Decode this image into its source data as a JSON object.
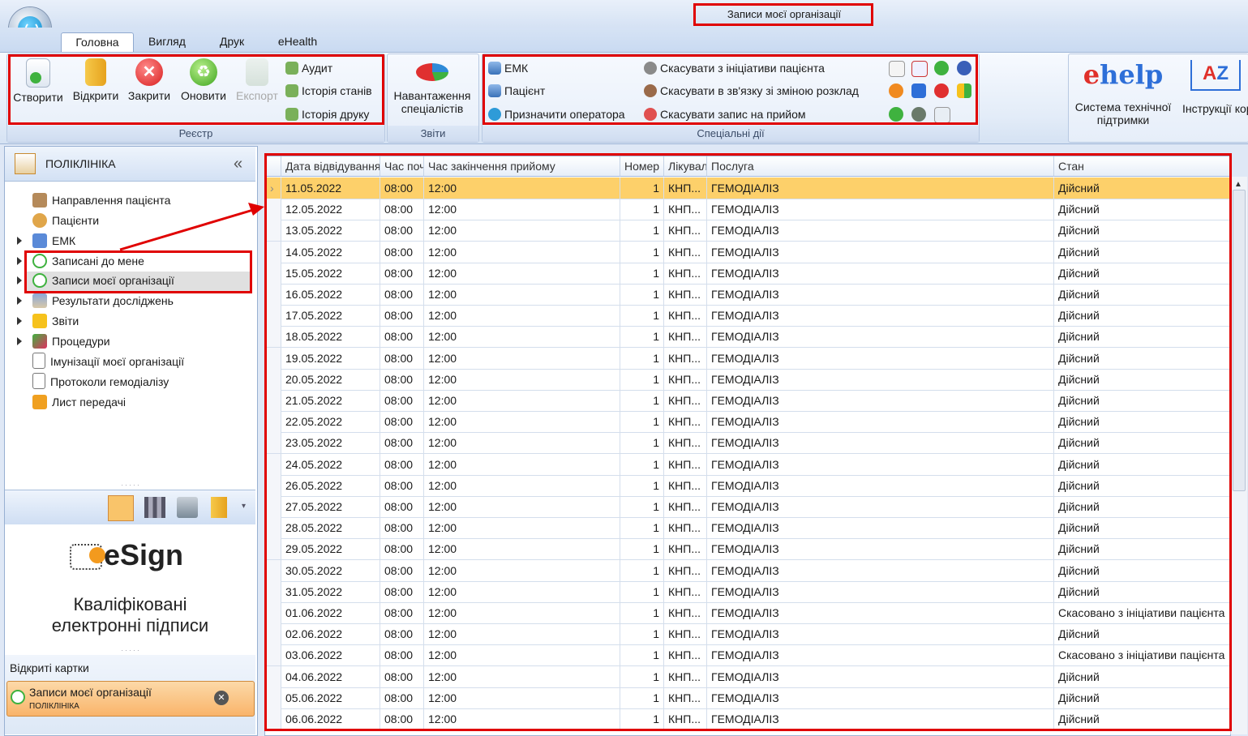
{
  "window": {
    "title": "Записи моєї організації"
  },
  "tabs": [
    "Головна",
    "Вигляд",
    "Друк",
    "eHealth"
  ],
  "ribbon": {
    "register": {
      "label": "Реєстр",
      "buttons": [
        "Створити",
        "Відкрити",
        "Закрити",
        "Оновити",
        "Експорт"
      ],
      "small": [
        "Аудит",
        "Історія станів",
        "Історія друку"
      ]
    },
    "reports": {
      "label": "Звіти",
      "button": "Навантаження спеціалістів"
    },
    "special": {
      "label": "Спеціальні дії",
      "col1": [
        "ЕМК",
        "Пацієнт",
        "Призначити оператора"
      ],
      "col2": [
        "Скасувати з ініціативи пацієнта",
        "Скасувати в зв'язку зі зміною розклад",
        "Скасувати запис на прийом"
      ]
    },
    "help": {
      "ehelp": "Система технічної підтримки",
      "az": "Інструкції користувача"
    }
  },
  "nav": {
    "title": "ПОЛІКЛІНІКА",
    "collapse": "«",
    "items": [
      "Направлення пацієнта",
      "Пацієнти",
      "ЕМК",
      "Записані до мене",
      "Записи моєї організації",
      "Результати досліджень",
      "Звіти",
      "Процедури",
      "Імунізації моєї організації",
      "Протоколи гемодіалізу",
      "Лист передачі"
    ]
  },
  "esign": {
    "brand": "eSign",
    "line1": "Кваліфіковані",
    "line2": "електронні підписи"
  },
  "open_cards": {
    "label": "Відкриті картки",
    "card_title": "Записи моєї організації",
    "card_sub": "ПОЛІКЛІНІКА"
  },
  "grid": {
    "headers": [
      "Дата відвідування",
      "Час початку",
      "Час закінчення прийому",
      "Номер",
      "Лікувальний заклад",
      "Послуга",
      "Стан"
    ],
    "rows": [
      [
        "11.05.2022",
        "08:00",
        "12:00",
        "1",
        "КНП...",
        "ГЕМОДІАЛІЗ",
        "Дійсний"
      ],
      [
        "12.05.2022",
        "08:00",
        "12:00",
        "1",
        "КНП...",
        "ГЕМОДІАЛІЗ",
        "Дійсний"
      ],
      [
        "13.05.2022",
        "08:00",
        "12:00",
        "1",
        "КНП...",
        "ГЕМОДІАЛІЗ",
        "Дійсний"
      ],
      [
        "14.05.2022",
        "08:00",
        "12:00",
        "1",
        "КНП...",
        "ГЕМОДІАЛІЗ",
        "Дійсний"
      ],
      [
        "15.05.2022",
        "08:00",
        "12:00",
        "1",
        "КНП...",
        "ГЕМОДІАЛІЗ",
        "Дійсний"
      ],
      [
        "16.05.2022",
        "08:00",
        "12:00",
        "1",
        "КНП...",
        "ГЕМОДІАЛІЗ",
        "Дійсний"
      ],
      [
        "17.05.2022",
        "08:00",
        "12:00",
        "1",
        "КНП...",
        "ГЕМОДІАЛІЗ",
        "Дійсний"
      ],
      [
        "18.05.2022",
        "08:00",
        "12:00",
        "1",
        "КНП...",
        "ГЕМОДІАЛІЗ",
        "Дійсний"
      ],
      [
        "19.05.2022",
        "08:00",
        "12:00",
        "1",
        "КНП...",
        "ГЕМОДІАЛІЗ",
        "Дійсний"
      ],
      [
        "20.05.2022",
        "08:00",
        "12:00",
        "1",
        "КНП...",
        "ГЕМОДІАЛІЗ",
        "Дійсний"
      ],
      [
        "21.05.2022",
        "08:00",
        "12:00",
        "1",
        "КНП...",
        "ГЕМОДІАЛІЗ",
        "Дійсний"
      ],
      [
        "22.05.2022",
        "08:00",
        "12:00",
        "1",
        "КНП...",
        "ГЕМОДІАЛІЗ",
        "Дійсний"
      ],
      [
        "23.05.2022",
        "08:00",
        "12:00",
        "1",
        "КНП...",
        "ГЕМОДІАЛІЗ",
        "Дійсний"
      ],
      [
        "24.05.2022",
        "08:00",
        "12:00",
        "1",
        "КНП...",
        "ГЕМОДІАЛІЗ",
        "Дійсний"
      ],
      [
        "26.05.2022",
        "08:00",
        "12:00",
        "1",
        "КНП...",
        "ГЕМОДІАЛІЗ",
        "Дійсний"
      ],
      [
        "27.05.2022",
        "08:00",
        "12:00",
        "1",
        "КНП...",
        "ГЕМОДІАЛІЗ",
        "Дійсний"
      ],
      [
        "28.05.2022",
        "08:00",
        "12:00",
        "1",
        "КНП...",
        "ГЕМОДІАЛІЗ",
        "Дійсний"
      ],
      [
        "29.05.2022",
        "08:00",
        "12:00",
        "1",
        "КНП...",
        "ГЕМОДІАЛІЗ",
        "Дійсний"
      ],
      [
        "30.05.2022",
        "08:00",
        "12:00",
        "1",
        "КНП...",
        "ГЕМОДІАЛІЗ",
        "Дійсний"
      ],
      [
        "31.05.2022",
        "08:00",
        "12:00",
        "1",
        "КНП...",
        "ГЕМОДІАЛІЗ",
        "Дійсний"
      ],
      [
        "01.06.2022",
        "08:00",
        "12:00",
        "1",
        "КНП...",
        "ГЕМОДІАЛІЗ",
        "Скасовано з ініціативи пацієнта"
      ],
      [
        "02.06.2022",
        "08:00",
        "12:00",
        "1",
        "КНП...",
        "ГЕМОДІАЛІЗ",
        "Дійсний"
      ],
      [
        "03.06.2022",
        "08:00",
        "12:00",
        "1",
        "КНП...",
        "ГЕМОДІАЛІЗ",
        "Скасовано з ініціативи пацієнта"
      ],
      [
        "04.06.2022",
        "08:00",
        "12:00",
        "1",
        "КНП...",
        "ГЕМОДІАЛІЗ",
        "Дійсний"
      ],
      [
        "05.06.2022",
        "08:00",
        "12:00",
        "1",
        "КНП...",
        "ГЕМОДІАЛІЗ",
        "Дійсний"
      ],
      [
        "06.06.2022",
        "08:00",
        "12:00",
        "1",
        "КНП...",
        "ГЕМОДІАЛІЗ",
        "Дійсний"
      ]
    ]
  },
  "colors": {
    "selected_row": "#fdd06a",
    "annotation": "#e00000",
    "ribbon": "#e3ecf8"
  }
}
